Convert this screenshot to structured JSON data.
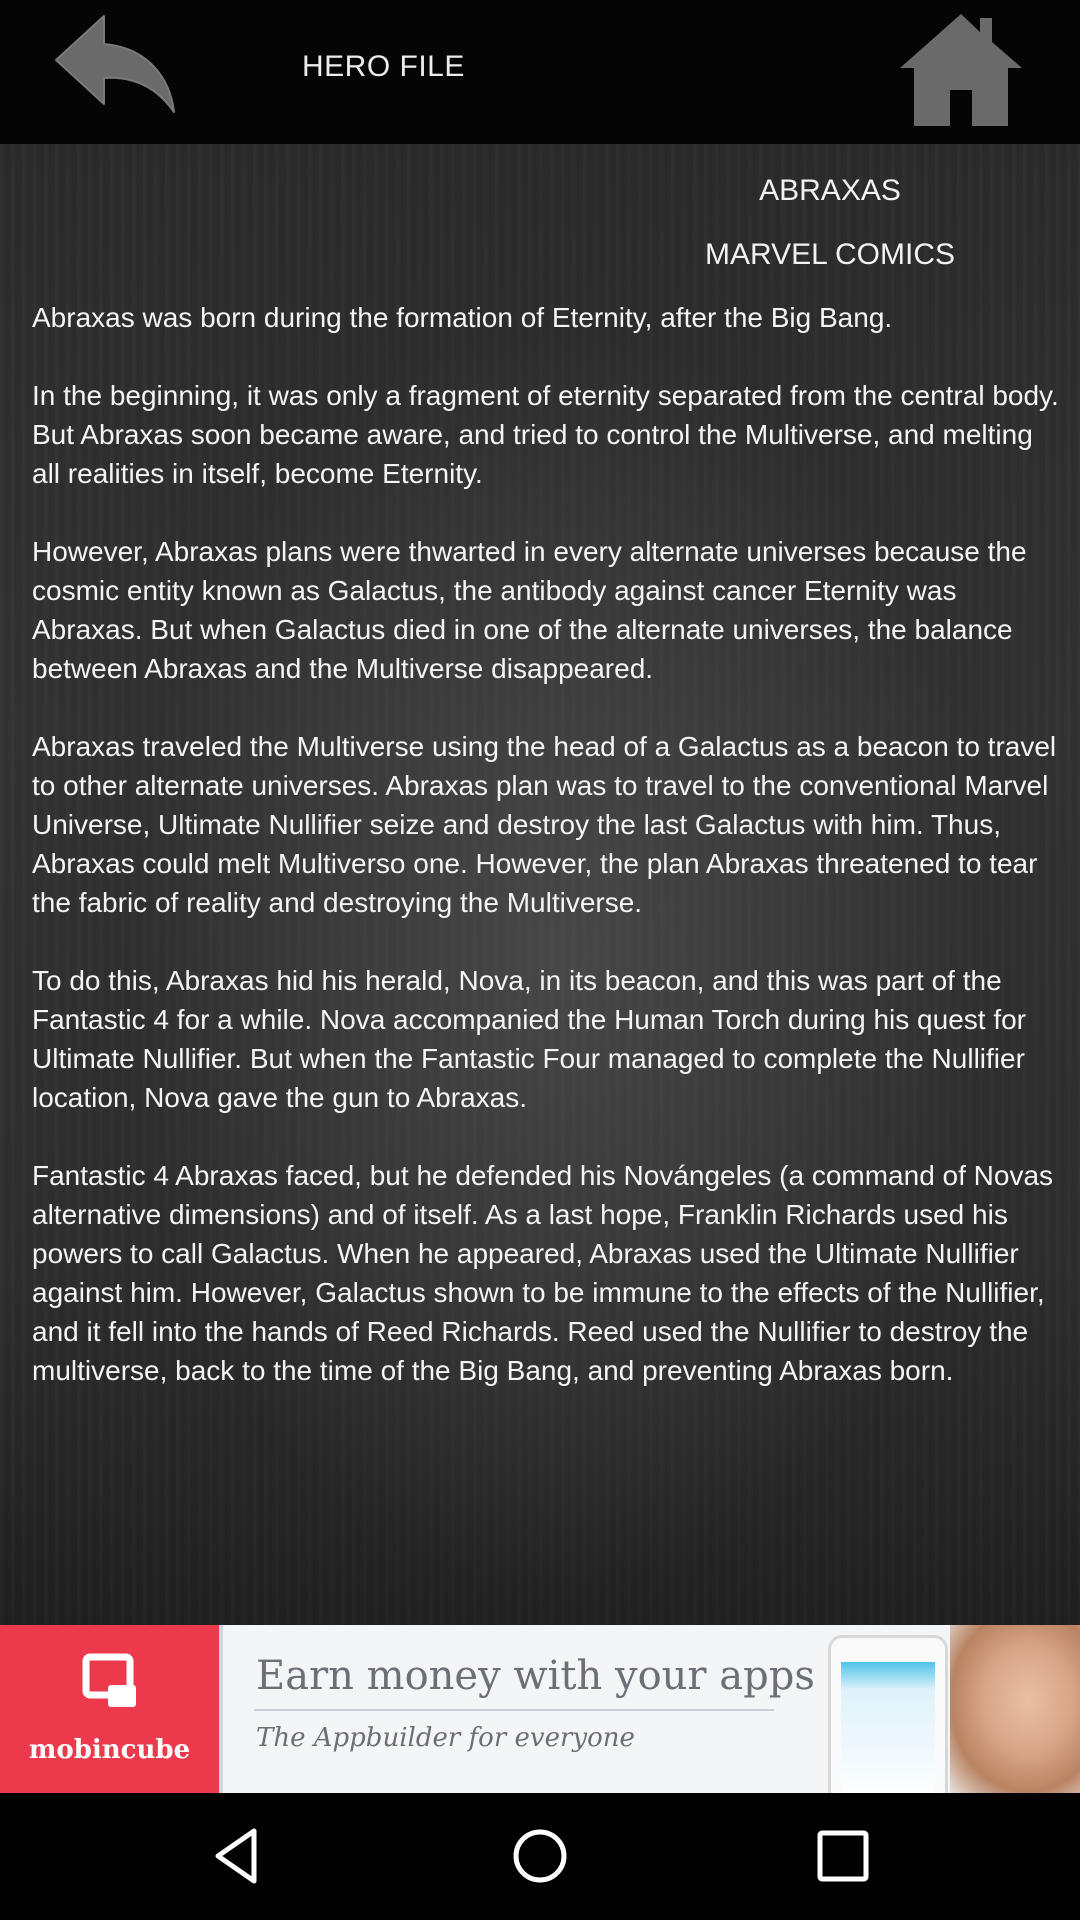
{
  "header": {
    "title": "HERO FILE",
    "back_icon": "back-arrow-icon",
    "home_icon": "home-icon"
  },
  "hero": {
    "name": "ABRAXAS",
    "publisher": "MARVEL COMICS",
    "paragraphs": [
      "Abraxas was born during the formation of Eternity, after the Big Bang.",
      "In the beginning, it was only a fragment of eternity separated from the central body. But Abraxas soon became aware, and tried to control the Multiverse, and melting all realities in itself, become Eternity.",
      "However, Abraxas plans were thwarted in every alternate universes because the cosmic entity known as Galactus, the antibody against cancer Eternity was Abraxas. But when Galactus died in one of the alternate universes, the balance between Abraxas and the Multiverse disappeared.",
      "Abraxas traveled the Multiverse using the head of a Galactus as a beacon to travel to other alternate universes. Abraxas plan was to travel to the conventional Marvel Universe, Ultimate Nullifier seize and destroy the last Galactus with him. Thus, Abraxas could melt Multiverso one. However, the plan Abraxas threatened to tear the fabric of reality and destroying the Multiverse.",
      "To do this, Abraxas hid his herald, Nova, in its beacon, and this was part of the Fantastic 4 for a while. Nova accompanied the Human Torch during his quest for Ultimate Nullifier. But when the Fantastic Four managed to complete the Nullifier location, Nova gave the gun to Abraxas.",
      "Fantastic 4 Abraxas faced, but he defended his Novángeles (a command of Novas alternative dimensions) and of itself. As a last hope, Franklin Richards used his powers to call Galactus. When he appeared, Abraxas used the Ultimate Nullifier against him. However, Galactus shown to be immune to the effects of the Nullifier, and it fell into the hands of Reed Richards. Reed used the Nullifier to destroy the multiverse, back to the time of the Big Bang, and preventing Abraxas born."
    ]
  },
  "ad": {
    "brand": "mobincube",
    "headline": "Earn money with your apps",
    "tagline": "The Appbuilder for everyone",
    "brand_color": "#ec3a4c"
  },
  "navbar": {
    "icons": [
      "back-triangle-icon",
      "home-circle-icon",
      "recents-square-icon"
    ]
  }
}
